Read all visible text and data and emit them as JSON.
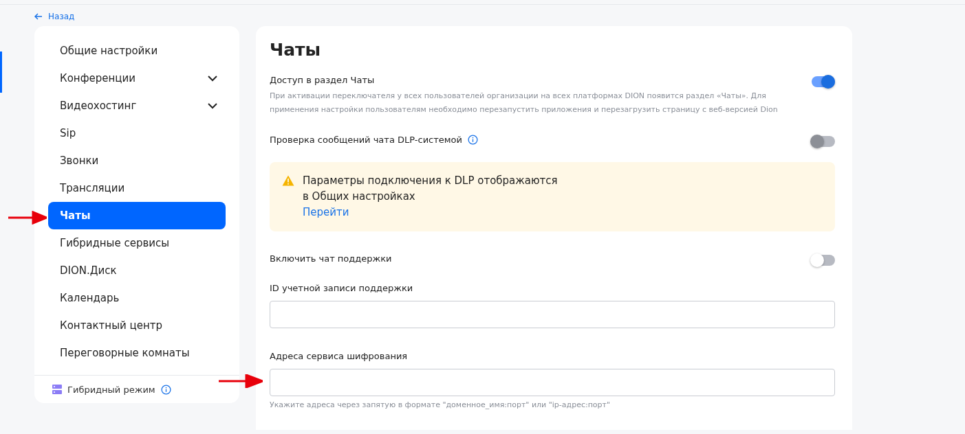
{
  "back_link": {
    "label": "Назад"
  },
  "sidebar": {
    "items": [
      {
        "label": "Общие настройки",
        "expandable": false,
        "selected": false
      },
      {
        "label": "Конференции",
        "expandable": true,
        "selected": false
      },
      {
        "label": "Видеохостинг",
        "expandable": true,
        "selected": false
      },
      {
        "label": "Sip",
        "expandable": false,
        "selected": false
      },
      {
        "label": "Звонки",
        "expandable": false,
        "selected": false
      },
      {
        "label": "Трансляции",
        "expandable": false,
        "selected": false
      },
      {
        "label": "Чаты",
        "expandable": false,
        "selected": true
      },
      {
        "label": "Гибридные сервисы",
        "expandable": false,
        "selected": false
      },
      {
        "label": "DION.Диск",
        "expandable": false,
        "selected": false
      },
      {
        "label": "Календарь",
        "expandable": false,
        "selected": false
      },
      {
        "label": "Контактный центр",
        "expandable": false,
        "selected": false
      },
      {
        "label": "Переговорные комнаты",
        "expandable": false,
        "selected": false
      }
    ],
    "footer": {
      "label": "Гибридный режим"
    }
  },
  "content": {
    "title": "Чаты",
    "settings": [
      {
        "kind": "toggle",
        "label": "Доступ в раздел Чаты",
        "info": false,
        "on": true,
        "disabled": false,
        "description": "При активации переключателя у всех пользователей организации на всех платформах DION появится раздел «Чаты». Для применения настройки пользователям необходимо перезапустить приложения и перезагрузить страницу с веб-версией Dion"
      },
      {
        "kind": "toggle",
        "label": "Проверка сообщений чата DLP-системой",
        "info": true,
        "on": false,
        "disabled": true
      },
      {
        "kind": "notice",
        "lines": [
          "Параметры подключения к DLP отображаются",
          "в Общих настройках"
        ],
        "link": "Перейти"
      },
      {
        "kind": "toggle",
        "label": "Включить чат поддержки",
        "info": false,
        "on": false,
        "disabled": false
      },
      {
        "kind": "field",
        "label": "ID учетной записи поддержки"
      },
      {
        "kind": "field",
        "label": "Адреса сервиса шифрования",
        "hint": "Укажите адреса через запятую в формате \"доменное_имя:порт\" или \"ip-адрес:порт\""
      }
    ]
  }
}
